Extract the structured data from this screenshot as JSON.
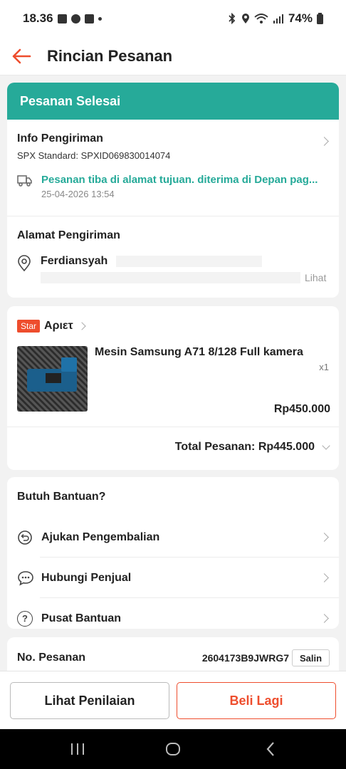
{
  "status_bar": {
    "time": "18.36",
    "battery": "74%"
  },
  "app_bar": {
    "title": "Rincian Pesanan"
  },
  "order_status": {
    "label": "Pesanan Selesai",
    "color": "#26aa99"
  },
  "shipping_info": {
    "title": "Info Pengiriman",
    "courier": "SPX Standard: SPXID069830014074",
    "tracking_status": "Pesanan tiba di alamat tujuan. diterima di Depan pag...",
    "tracking_time": "25-04-2026 13:54",
    "status_color": "#26aa99"
  },
  "address": {
    "title": "Alamat Pengiriman",
    "name": "Ferdiansyah",
    "view_label": "Lihat"
  },
  "shop": {
    "badge": "Star",
    "name": "Αριετ"
  },
  "product": {
    "name": "Mesin Samsung A71 8/128 Full kamera",
    "quantity": "x1",
    "price": "Rp450.000"
  },
  "order_total": {
    "label": "Total Pesanan: Rp445.000"
  },
  "help": {
    "title": "Butuh Bantuan?",
    "items": [
      {
        "label": "Ajukan Pengembalian",
        "icon": "return-icon"
      },
      {
        "label": "Hubungi Penjual",
        "icon": "chat-icon"
      },
      {
        "label": "Pusat Bantuan",
        "icon": "help-icon"
      }
    ]
  },
  "order_number": {
    "label": "No. Pesanan",
    "value": "2604173B9JWRG7",
    "copy_label": "Salin"
  },
  "actions": {
    "review_label": "Lihat Penilaian",
    "buy_again_label": "Beli Lagi",
    "accent": "#ee4d2d"
  }
}
